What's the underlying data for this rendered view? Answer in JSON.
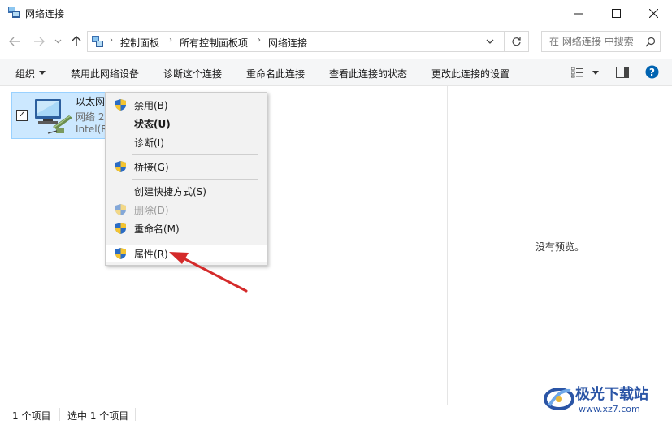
{
  "window": {
    "title": "网络连接",
    "minimize_glyph": "—",
    "maximize_glyph": "☐",
    "close_glyph": "✕"
  },
  "address": {
    "breadcrumb": [
      "控制面板",
      "所有控制面板项",
      "网络连接"
    ],
    "search_placeholder": "在 网络连接 中搜索"
  },
  "toolbar": {
    "items": [
      "组织",
      "禁用此网络设备",
      "诊断这个连接",
      "重命名此连接",
      "查看此连接的状态",
      "更改此连接的设置"
    ]
  },
  "connection": {
    "name": "以太网",
    "network": "网络 2",
    "adapter": "Intel(R"
  },
  "context_menu": {
    "items": [
      {
        "label": "禁用(B)",
        "shield": true
      },
      {
        "label": "状态(U)",
        "bold": true
      },
      {
        "label": "诊断(I)"
      },
      {
        "label": "桥接(G)",
        "shield": true
      },
      {
        "label": "创建快捷方式(S)"
      },
      {
        "label": "删除(D)",
        "shield": true,
        "disabled": true
      },
      {
        "label": "重命名(M)",
        "shield": true
      },
      {
        "label": "属性(R)",
        "shield": true,
        "highlighted": true
      }
    ]
  },
  "preview": {
    "message": "没有预览。"
  },
  "status": {
    "item_count": "1 个项目",
    "selected": "选中 1 个项目"
  },
  "watermark": {
    "text": "极光下载站",
    "url": "www.xz7.com"
  },
  "colors": {
    "accent": "#0078d7",
    "selection": "#cce8ff",
    "arrow": "#d42a2a",
    "watermark": "#2b55a6"
  }
}
